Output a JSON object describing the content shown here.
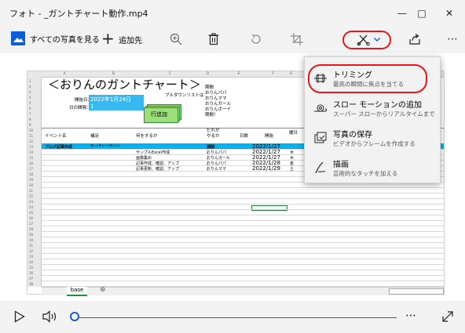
{
  "window": {
    "title": "フォト - _ガントチャート動作.mp4",
    "minimize": "—",
    "maximize": "□",
    "close": "✕"
  },
  "toolbar": {
    "all_photos": "すべての写真を見る",
    "add_to": "追加先",
    "more": "⋯",
    "accent": "#0a5fd6",
    "highlight": "#e8151b"
  },
  "sheet": {
    "col_headers": [
      "A",
      "B",
      "C",
      "D",
      "E",
      "F",
      "G",
      "H",
      "I",
      "J"
    ],
    "title": "＜おりんのガントチャート＞",
    "pulldown_label": "プルダウンリストは",
    "start_label": "開始日：",
    "display_label": "日の間隔：",
    "start_value": "2022年1月24日",
    "interval_value": "1",
    "add_row_label": "行追加",
    "pulldown_items": [
      "期間",
      "おりんパパ",
      "おりんママ",
      "おりんガール",
      "おりんボーイ",
      "期間！"
    ],
    "headers": {
      "event": "イベント名",
      "note": "補足",
      "todo": "何をするか",
      "who": "だれが\nやるか",
      "days": "日数",
      "start": "開始",
      "weekday": "曜日"
    },
    "rows": [
      {
        "event": "ブログ記事作成",
        "note": "ガントチャートテレソン",
        "todo": "",
        "who": "期間",
        "days": "",
        "start": "2022/1/27",
        "wd": ""
      },
      {
        "event": "",
        "note": "",
        "todo": "サンプルExcel作成",
        "who": "おりんパパ",
        "days": "",
        "start": "2022/1/27",
        "wd": "木"
      },
      {
        "event": "",
        "note": "",
        "todo": "画像集め",
        "who": "おりんガール",
        "days": "",
        "start": "2022/1/27",
        "wd": "木"
      },
      {
        "event": "",
        "note": "",
        "todo": "記事作成、確認、アップ",
        "who": "おりんパパ",
        "days": "",
        "start": "2022/1/28",
        "wd": "金"
      },
      {
        "event": "",
        "note": "",
        "todo": "記事更新、確認、アップ",
        "who": "おりんママ",
        "days": "",
        "start": "2022/1/29",
        "wd": "土"
      }
    ],
    "right_cells": [
      "3",
      "木"
    ],
    "tab_name": "base",
    "row_numbers": [
      "1",
      "2",
      "3",
      "4",
      "5",
      "6",
      "7",
      "8",
      "9",
      "10",
      "11",
      "12",
      "13",
      "14",
      "15",
      "16",
      "17",
      "18",
      "19",
      "20",
      "21",
      "22",
      "23",
      "24",
      "25",
      "26",
      "27",
      "28",
      "29",
      "30",
      "31",
      "32",
      "33",
      "34",
      "35",
      "36",
      "37",
      "38"
    ]
  },
  "menu": {
    "items": [
      {
        "title": "トリミング",
        "subtitle": "最高の瞬間に焦点を当てる",
        "icon": "trim-icon"
      },
      {
        "title": "スロー モーションの追加",
        "subtitle": "スーパー スローからリアルタイムまで",
        "icon": "snail-icon"
      },
      {
        "title": "写真の保存",
        "subtitle": "ビデオからフレームを作成する",
        "icon": "save-frame-icon"
      },
      {
        "title": "描画",
        "subtitle": "芸術的なタッチを加える",
        "icon": "pen-icon"
      }
    ]
  },
  "player": {
    "more": "⋯",
    "progress": 0
  }
}
